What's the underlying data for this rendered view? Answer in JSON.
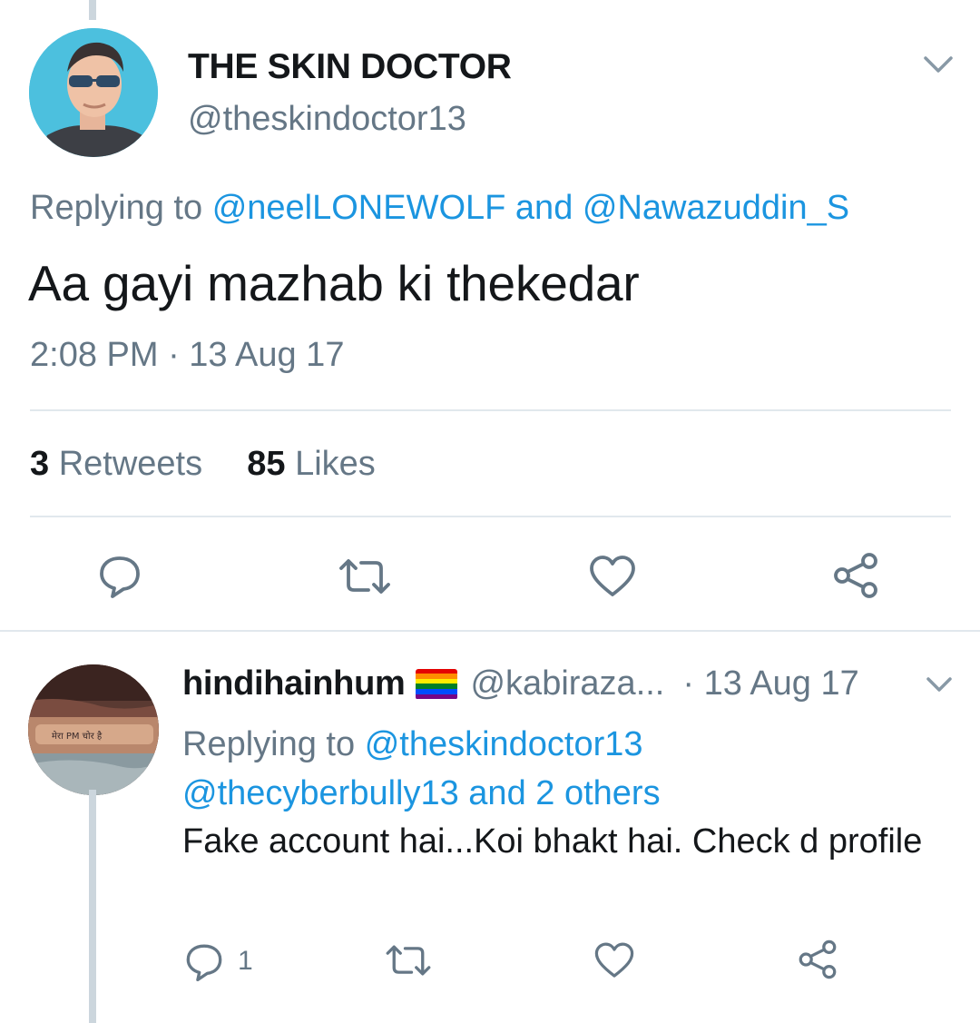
{
  "tweet": {
    "display_name": "THE SKIN DOCTOR",
    "handle": "@theskindoctor13",
    "replying_prefix": "Replying to",
    "replying_user1": "@neelLONEWOLF",
    "replying_and": "and",
    "replying_user2": "@Nawazuddin_S",
    "text": "Aa gayi mazhab ki thekedar",
    "timestamp": "2:08 PM · 13 Aug 17",
    "retweets_count": "3",
    "retweets_label": "Retweets",
    "likes_count": "85",
    "likes_label": "Likes"
  },
  "reply": {
    "display_name": "hindihainhum",
    "handle": "@kabiraza...",
    "date": "· 13 Aug 17",
    "replying_prefix": "Replying to",
    "replying_user1": "@theskindoctor13",
    "replying_rest": "@thecyberbully13 and 2 others",
    "text": "Fake account hai...Koi bhakt hai. Check d profile",
    "reply_count": "1"
  },
  "icons": {
    "reply": "reply-icon",
    "retweet": "retweet-icon",
    "like": "heart-icon",
    "share": "share-icon",
    "caret": "chevron-down-icon",
    "flag": "rainbow-flag-icon"
  },
  "colors": {
    "link": "#1b95e0",
    "muted": "#657786",
    "text": "#14171a",
    "divider": "#e1e8ed",
    "thread_line": "#ccd6dd"
  }
}
